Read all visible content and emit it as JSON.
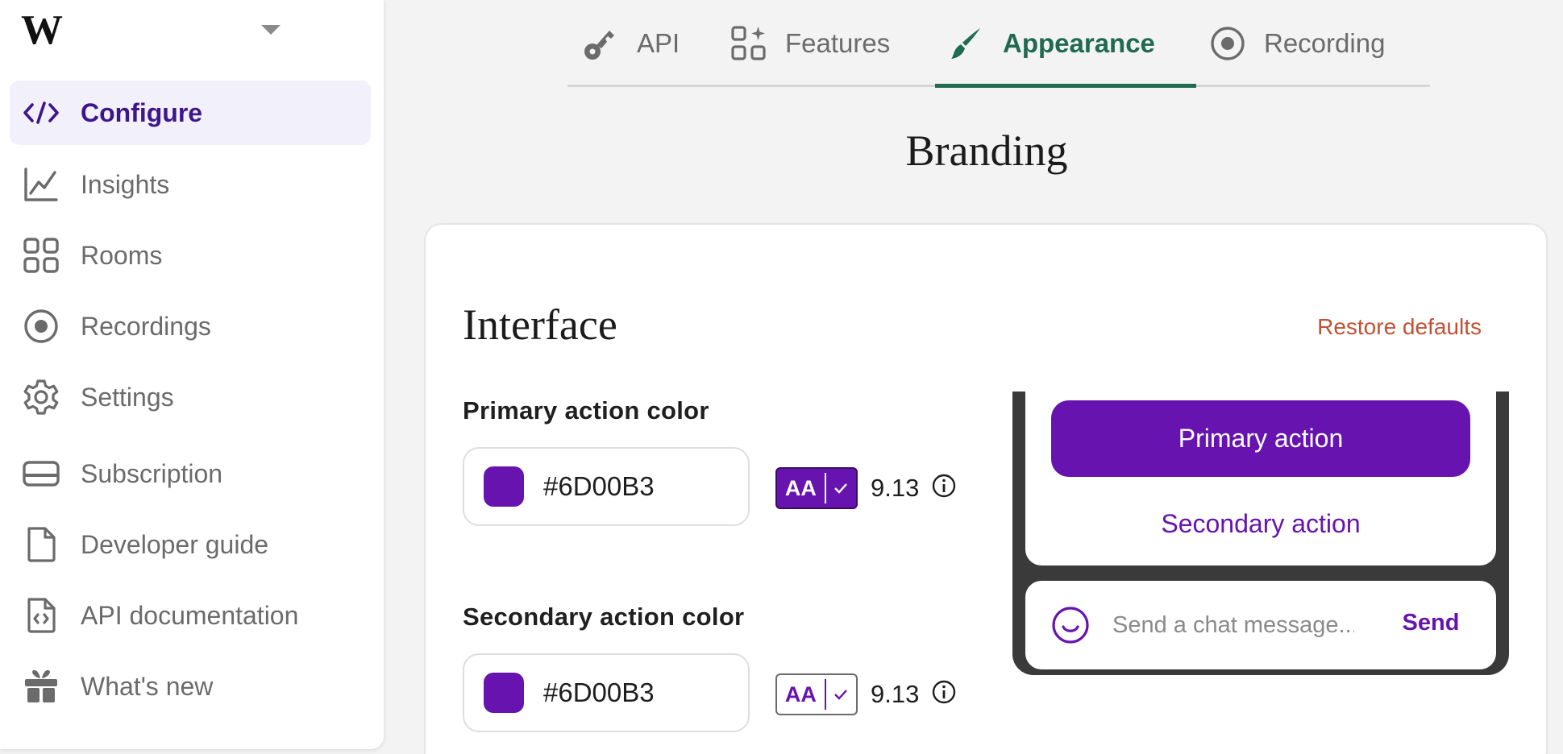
{
  "sidebar": {
    "workspace_name": "",
    "items": [
      {
        "label": "Configure",
        "icon": "code-icon"
      },
      {
        "label": "Insights",
        "icon": "chart-icon"
      },
      {
        "label": "Rooms",
        "icon": "grid-icon"
      },
      {
        "label": "Recordings",
        "icon": "record-icon"
      },
      {
        "label": "Settings",
        "icon": "gear-icon"
      },
      {
        "label": "Subscription",
        "icon": "card-icon"
      },
      {
        "label": "Developer guide",
        "icon": "document-icon"
      },
      {
        "label": "API documentation",
        "icon": "code-document-icon"
      },
      {
        "label": "What's new",
        "icon": "gift-icon"
      }
    ]
  },
  "tabs": [
    {
      "label": "API",
      "icon": "key-icon"
    },
    {
      "label": "Features",
      "icon": "features-icon"
    },
    {
      "label": "Appearance",
      "icon": "brush-icon",
      "active": true
    },
    {
      "label": "Recording",
      "icon": "record-icon"
    }
  ],
  "page": {
    "title": "Branding"
  },
  "interface": {
    "title": "Interface",
    "restore_label": "Restore defaults",
    "primary": {
      "label": "Primary action color",
      "hex": "#6D00B3",
      "badge": "AA",
      "ratio": "9.13"
    },
    "secondary": {
      "label": "Secondary action color",
      "hex": "#6D00B3",
      "badge": "AA",
      "ratio": "9.13"
    }
  },
  "preview": {
    "primary_button": "Primary action",
    "secondary_button": "Secondary action",
    "chat_placeholder": "Send a chat message...",
    "send_label": "Send"
  },
  "colors": {
    "accent_purple": "#6713b0",
    "active_nav_text": "#3e168c",
    "active_tab_green": "#1f6a51",
    "restore_orange": "#c05135"
  }
}
